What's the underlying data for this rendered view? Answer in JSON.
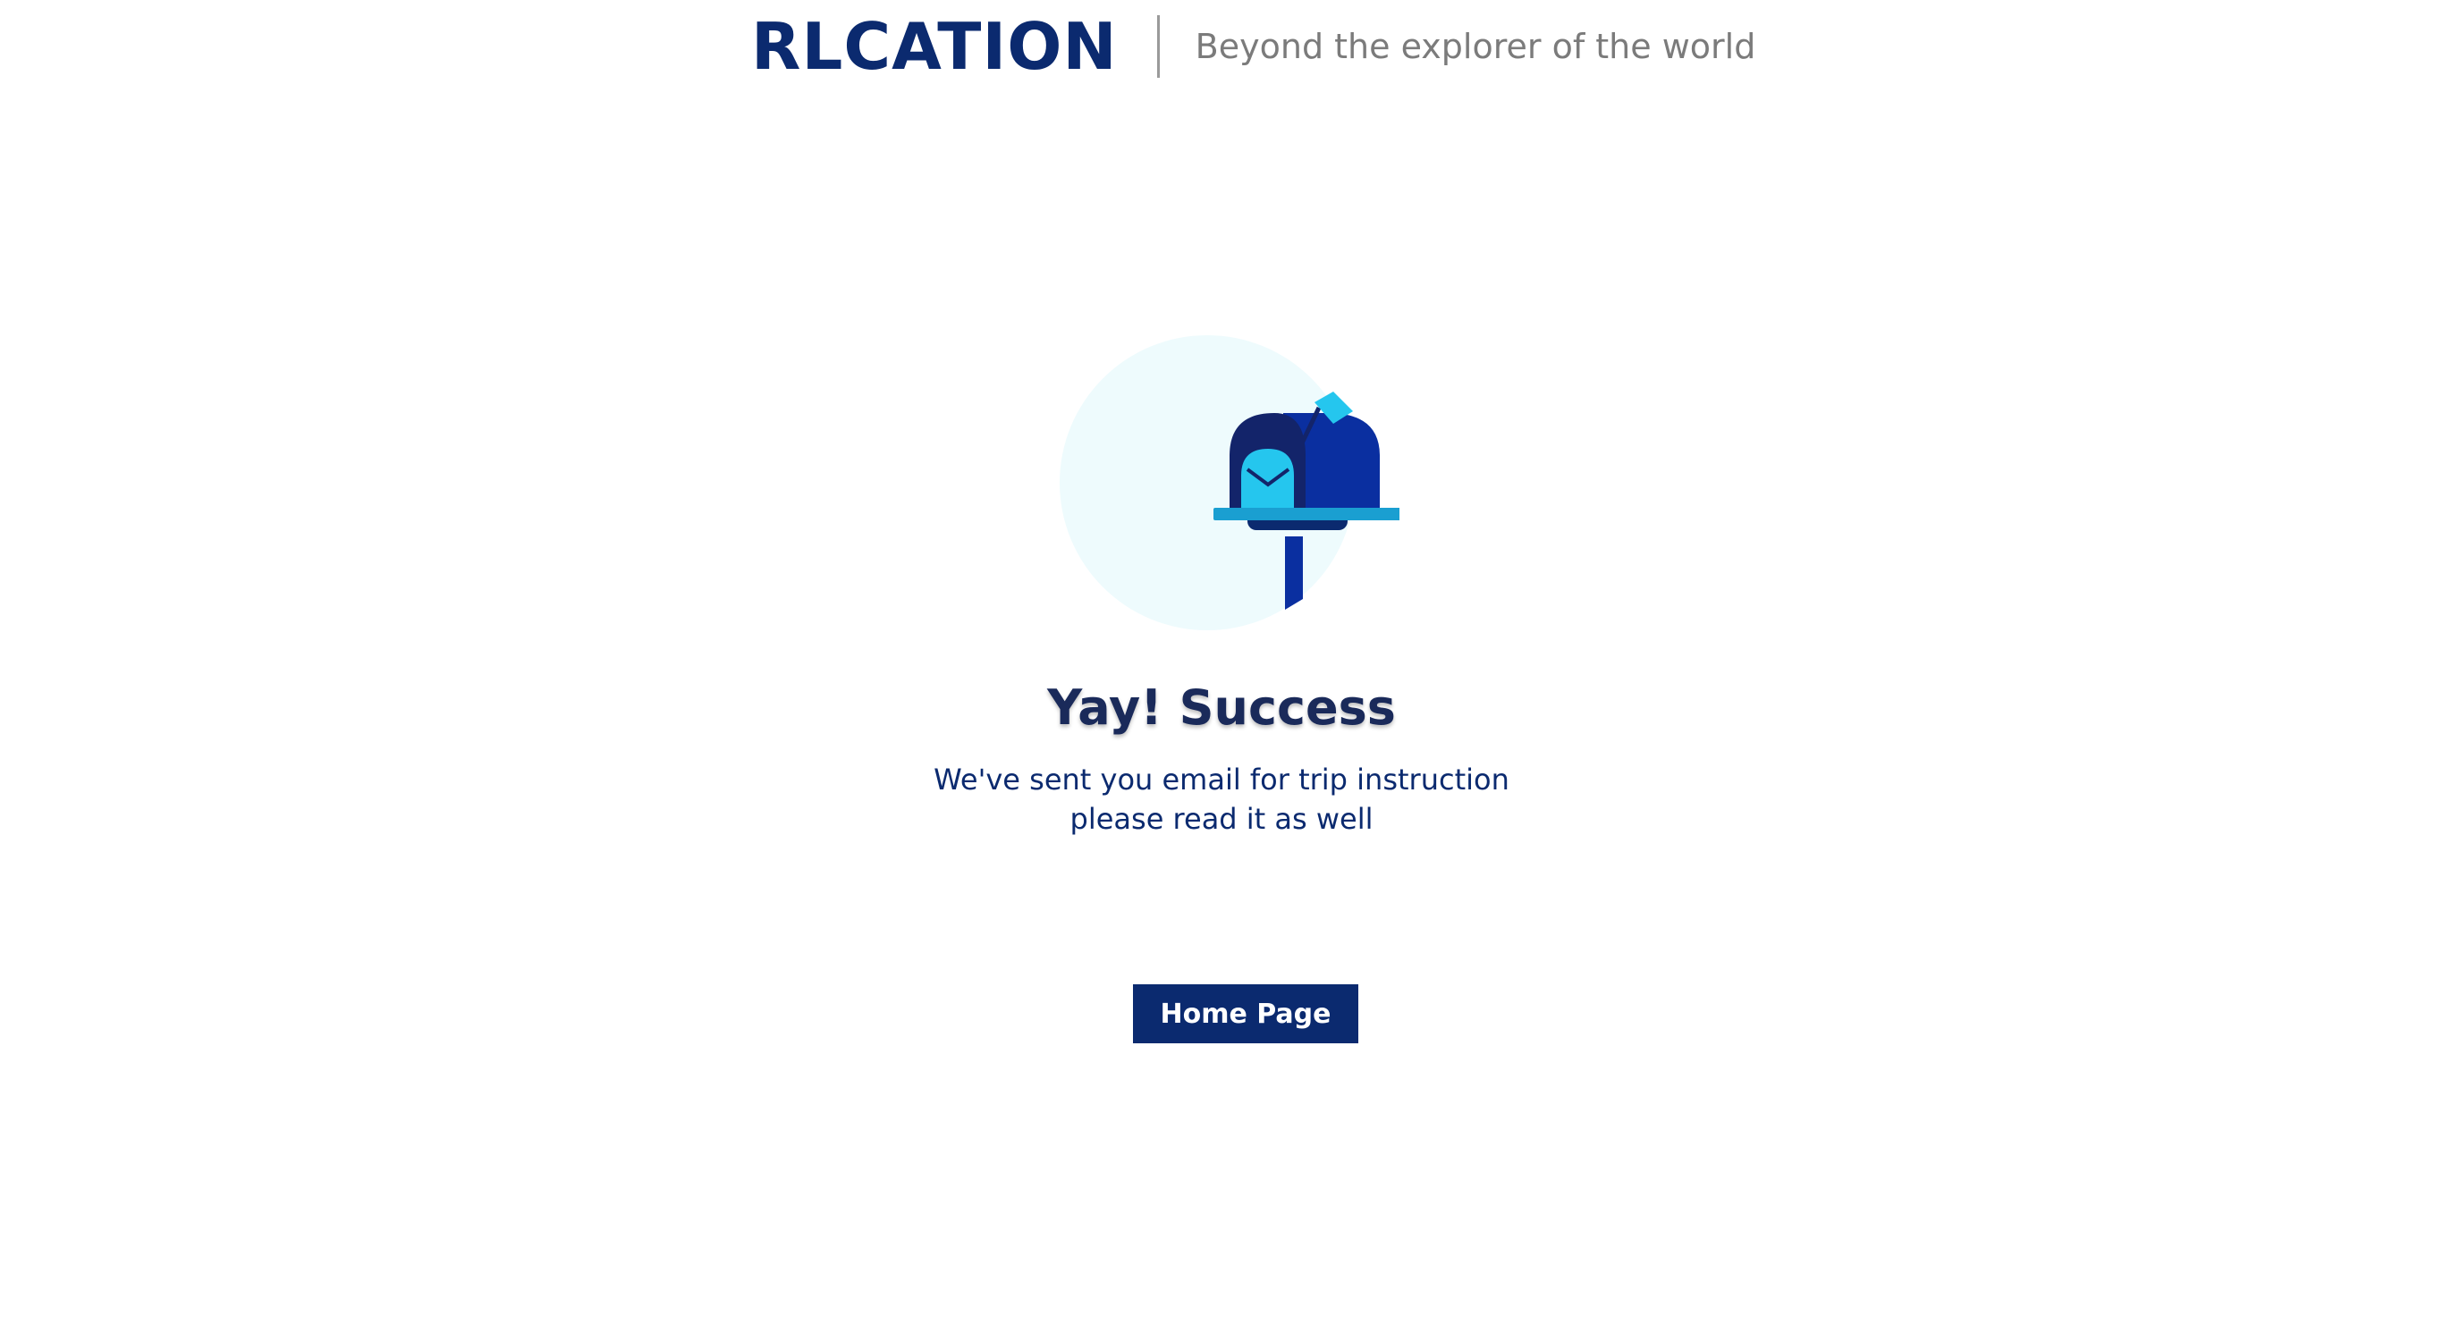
{
  "header": {
    "logo_text": "RLCATION",
    "tagline": "Beyond the explorer of the world"
  },
  "main": {
    "illustration": "mailbox-icon",
    "title": "Yay! Success",
    "message_line1": "We've sent you email for trip instruction",
    "message_line2": "please read it as well",
    "home_button_label": "Home Page"
  },
  "colors": {
    "brand_navy": "#0b2a6f",
    "tagline_gray": "#7b7b7b",
    "circle_bg": "#eefbfd",
    "mailbox_blue": "#0a2fa0",
    "letter_cyan": "#25c6ee"
  }
}
